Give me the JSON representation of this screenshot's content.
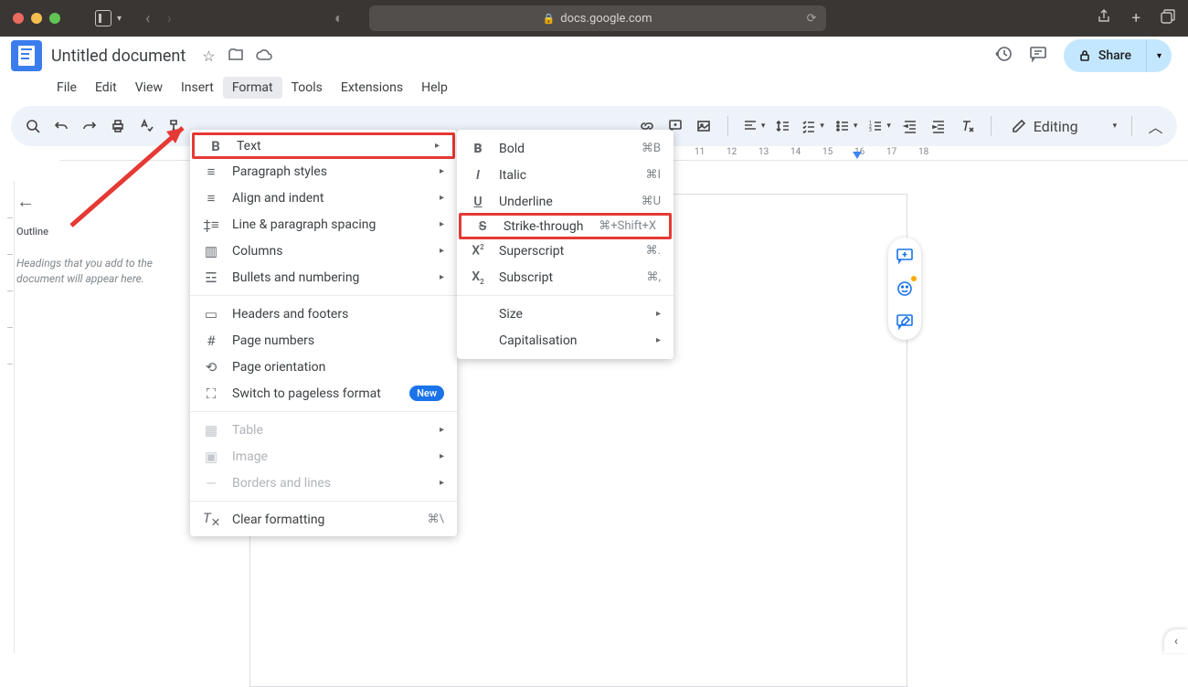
{
  "browser": {
    "url_host": "docs.google.com"
  },
  "doc": {
    "title": "Untitled document"
  },
  "menubar": [
    "File",
    "Edit",
    "View",
    "Insert",
    "Format",
    "Tools",
    "Extensions",
    "Help"
  ],
  "share": {
    "label": "Share"
  },
  "editing": {
    "label": "Editing"
  },
  "outline": {
    "title": "Outline",
    "hint": "Headings that you add to the document will appear here."
  },
  "ruler_h": [
    "11",
    "12",
    "13",
    "14",
    "15",
    "16",
    "17",
    "18"
  ],
  "format_menu": {
    "text": "Text",
    "paragraph": "Paragraph styles",
    "align": "Align and indent",
    "spacing": "Line & paragraph spacing",
    "columns": "Columns",
    "bullets": "Bullets and numbering",
    "headers": "Headers and footers",
    "pagenum": "Page numbers",
    "orientation": "Page orientation",
    "pageless": "Switch to pageless format",
    "new": "New",
    "table": "Table",
    "image": "Image",
    "borders": "Borders and lines",
    "clear": "Clear formatting",
    "clear_sc": "⌘\\"
  },
  "text_submenu": {
    "bold": "Bold",
    "bold_sc": "⌘B",
    "italic": "Italic",
    "italic_sc": "⌘I",
    "underline": "Underline",
    "underline_sc": "⌘U",
    "strike": "Strike-through",
    "strike_sc": "⌘+Shift+X",
    "super": "Superscript",
    "super_sc": "⌘.",
    "sub": "Subscript",
    "sub_sc": "⌘,",
    "size": "Size",
    "cap": "Capitalisation"
  }
}
